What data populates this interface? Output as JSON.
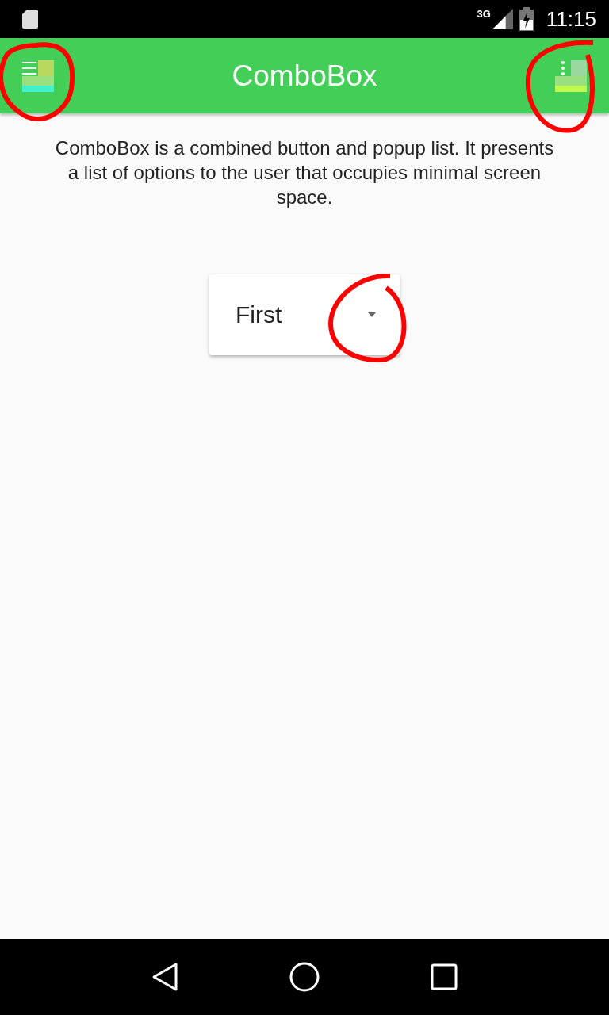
{
  "status_bar": {
    "network": "3G",
    "time": "11:15"
  },
  "app_bar": {
    "title": "ComboBox"
  },
  "description": "ComboBox is a combined button and popup list. It presents a list of options to the user that occupies minimal screen space.",
  "combo_box": {
    "value": "First"
  }
}
